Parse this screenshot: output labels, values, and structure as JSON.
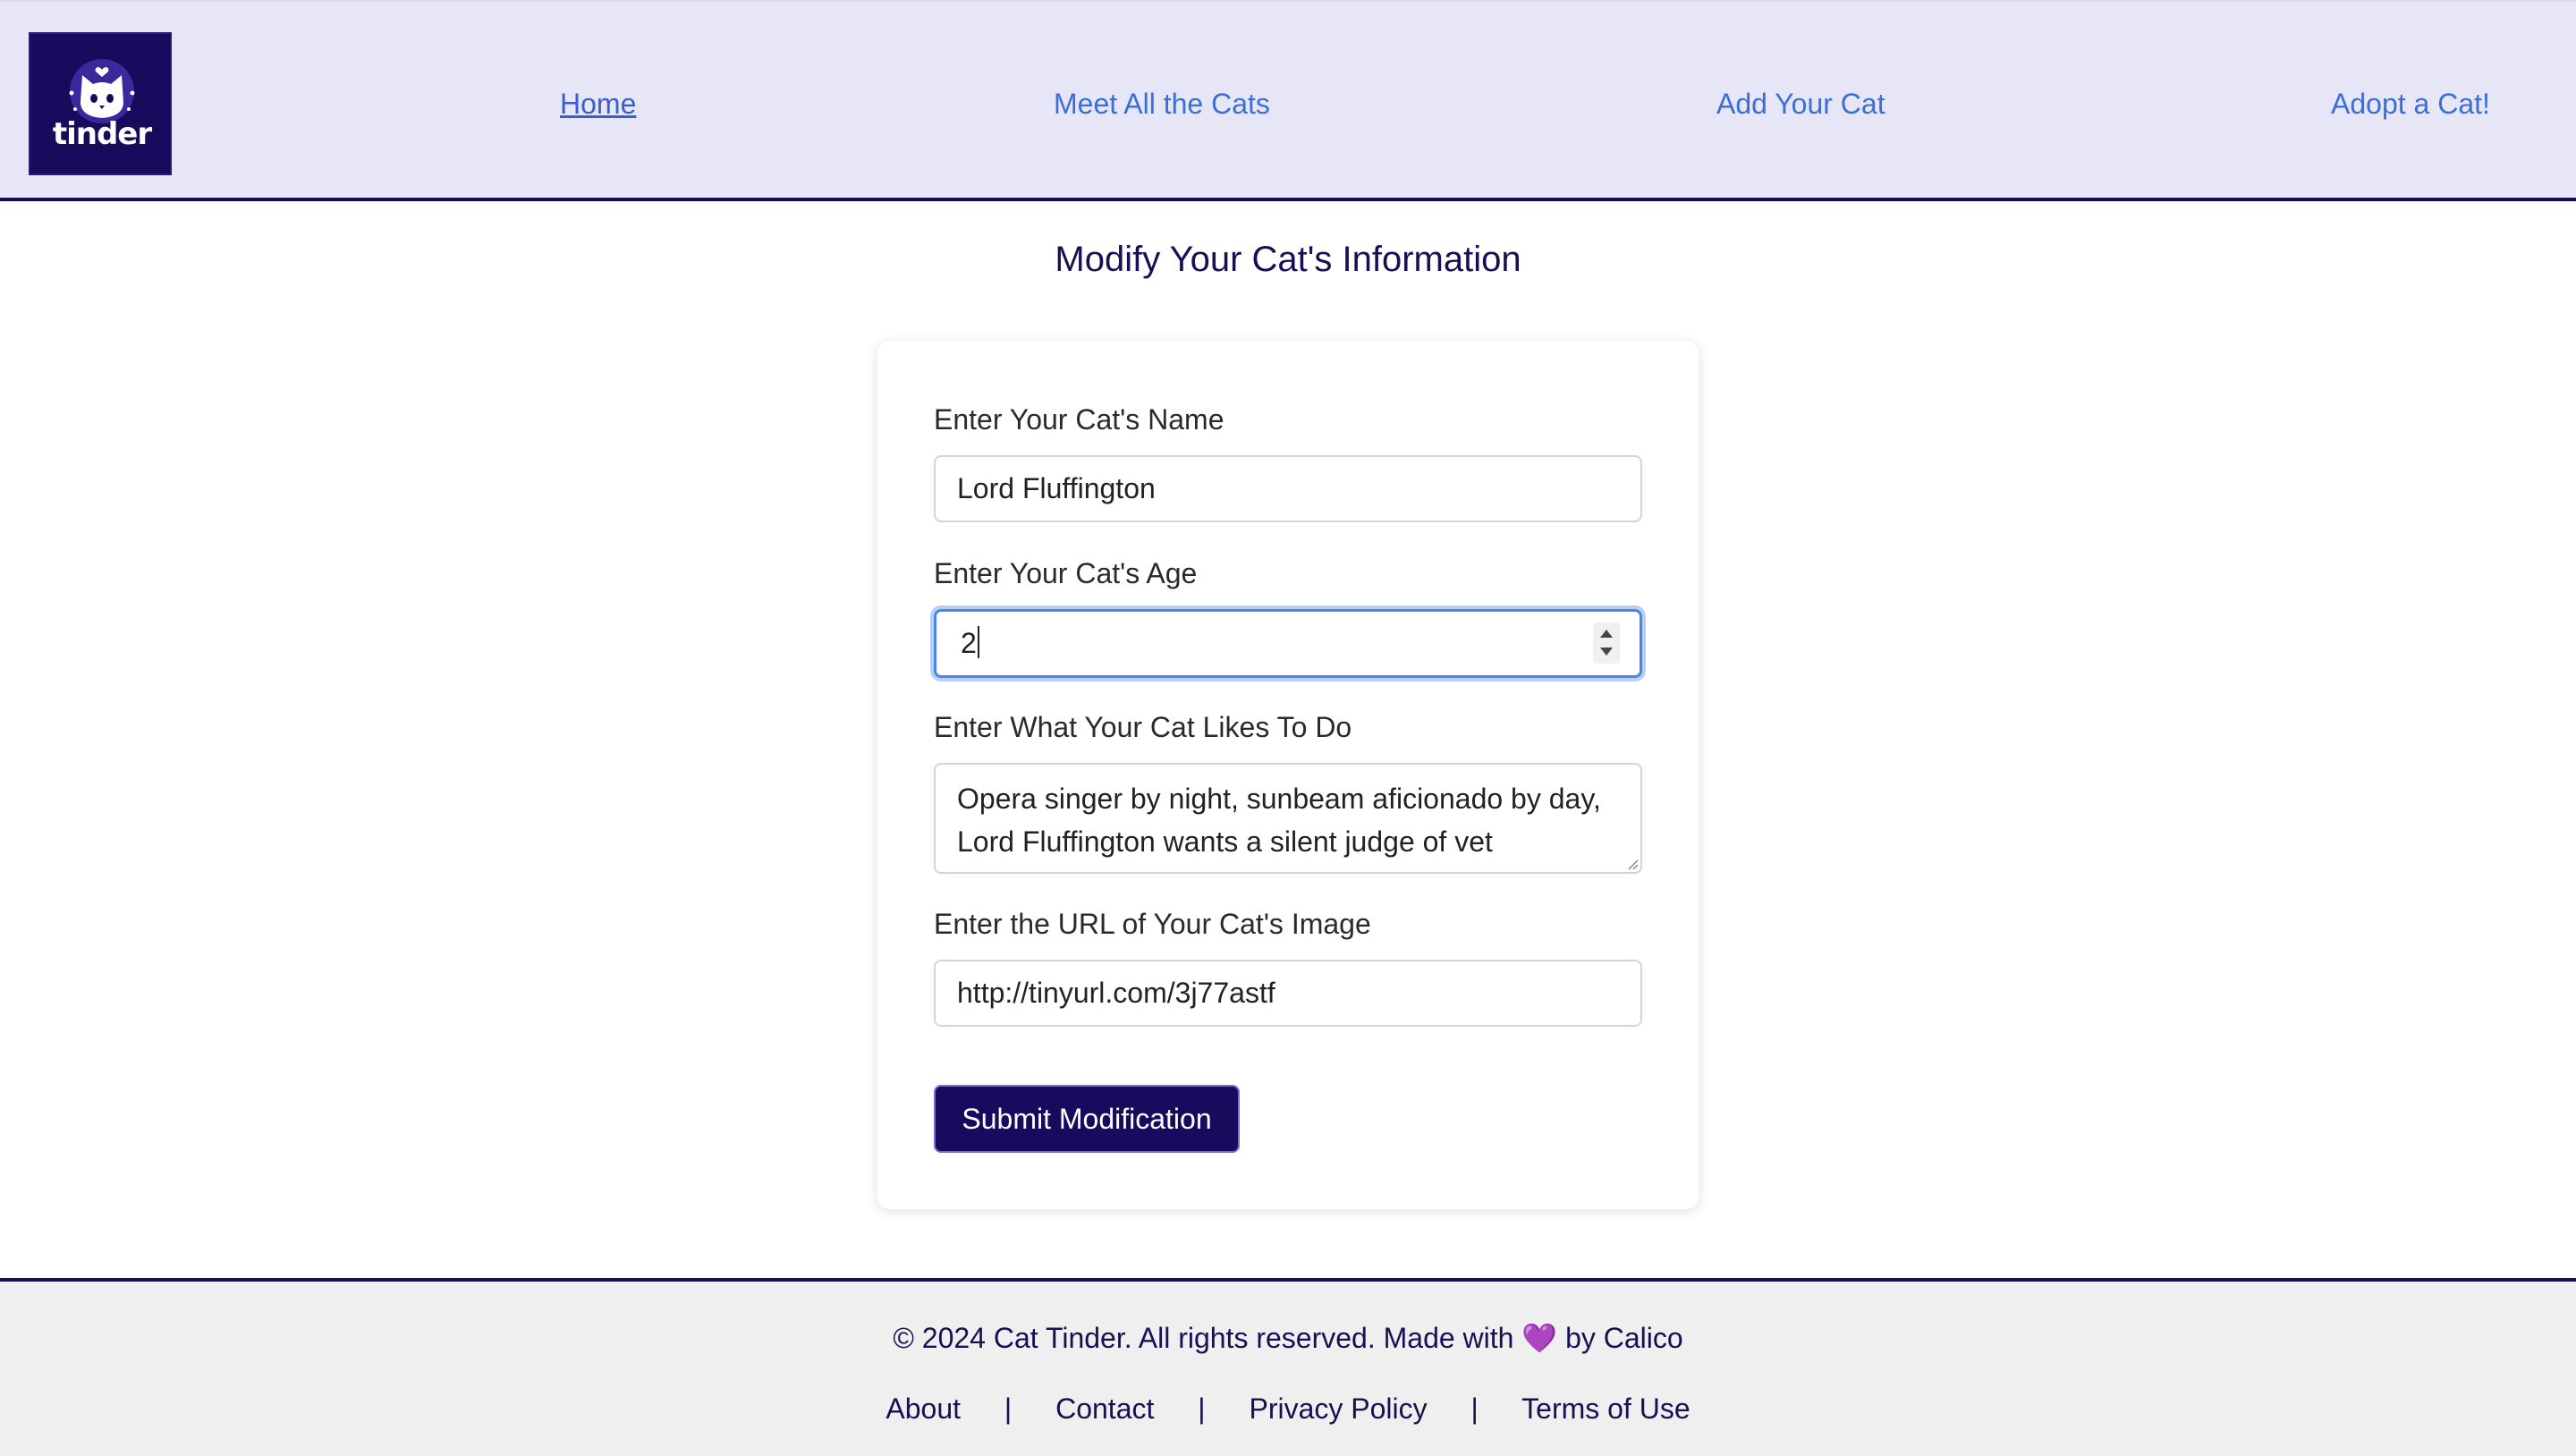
{
  "brand": {
    "logo_text": "tinder",
    "logo_icon": "cat-heart-icon",
    "logo_bg": "#1a0a5e"
  },
  "nav": {
    "home": "Home",
    "meet": "Meet All the Cats",
    "add": "Add Your Cat",
    "adopt": "Adopt a Cat!"
  },
  "page": {
    "title": "Modify Your Cat's Information"
  },
  "form": {
    "name_label": "Enter Your Cat's Name",
    "name_value": "Lord Fluffington",
    "age_label": "Enter Your Cat's Age",
    "age_value": "2",
    "likes_label": "Enter What Your Cat Likes To Do",
    "likes_value": "Opera singer by night, sunbeam aficionado by day, Lord Fluffington wants a silent judge of vet",
    "image_label": "Enter the URL of Your Cat's Image",
    "image_value": "http://tinyurl.com/3j77astf",
    "submit_label": "Submit Modification"
  },
  "footer": {
    "copyright_prefix": "© 2024 Cat Tinder. All rights reserved. Made with",
    "heart": "💜",
    "copyright_suffix": "by Calico",
    "links": {
      "about": "About",
      "contact": "Contact",
      "privacy": "Privacy Policy",
      "terms": "Terms of Use"
    },
    "separator": "|"
  },
  "colors": {
    "header_bg": "#e6e6f7",
    "primary_dark": "#1a0f52",
    "nav_link": "#3b6fd6",
    "focus_ring": "#4a86e8",
    "footer_bg": "#efefef"
  }
}
